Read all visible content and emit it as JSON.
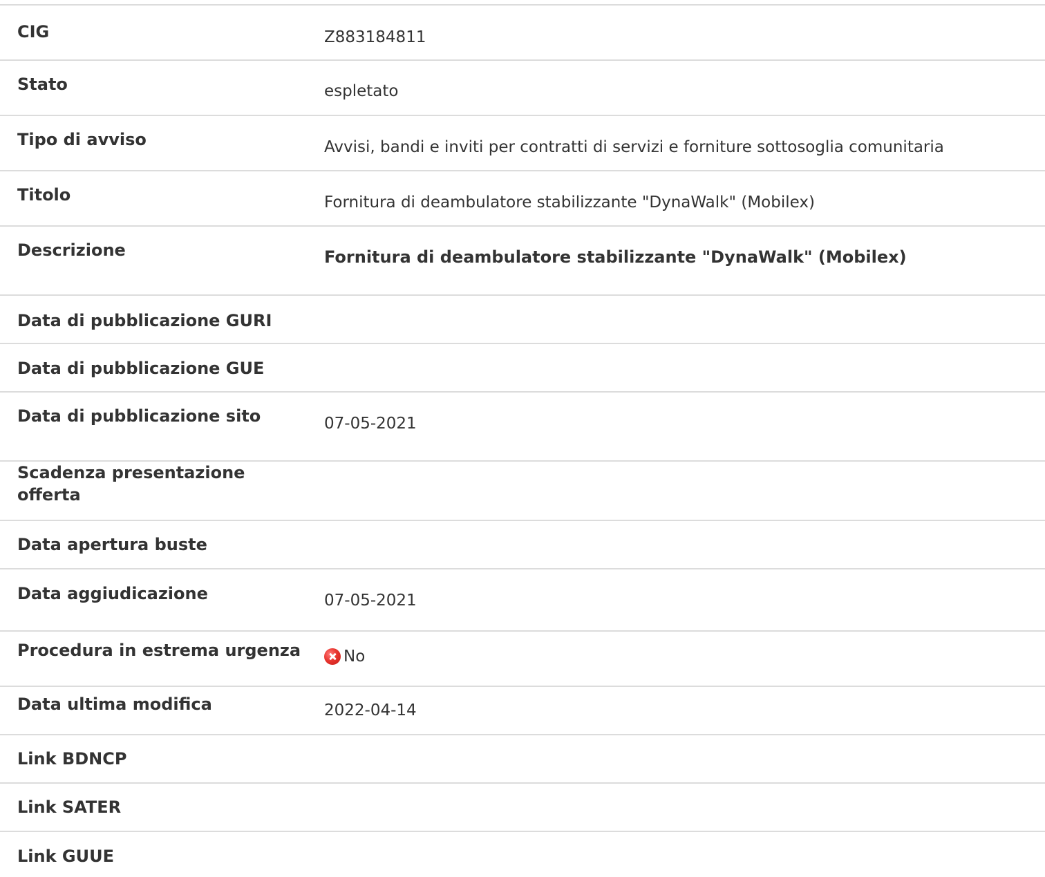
{
  "rows": [
    {
      "label": "CIG",
      "value": "Z883184811"
    },
    {
      "label": "Stato",
      "value": "espletato"
    },
    {
      "label": "Tipo di avviso",
      "value": "Avvisi, bandi e inviti per contratti di servizi e forniture sottosoglia comunitaria"
    },
    {
      "label": "Titolo",
      "value": "Fornitura di deambulatore stabilizzante \"DynaWalk\" (Mobilex)"
    },
    {
      "label": "Descrizione",
      "value": "Fornitura di deambulatore stabilizzante \"DynaWalk\" (Mobilex)"
    },
    {
      "label": "Data di pubblicazione GURI",
      "value": ""
    },
    {
      "label": "Data di pubblicazione GUE",
      "value": ""
    },
    {
      "label": "Data di pubblicazione sito",
      "value": "07-05-2021"
    },
    {
      "label": "Scadenza presentazione offerta",
      "value": ""
    },
    {
      "label": "Data apertura buste",
      "value": ""
    },
    {
      "label": "Data aggiudicazione",
      "value": "07-05-2021"
    },
    {
      "label": "Procedura in estrema urgenza",
      "value": "No",
      "icon": "red-x-circle-icon"
    },
    {
      "label": "Data ultima modifica",
      "value": "2022-04-14"
    },
    {
      "label": "Link BDNCP",
      "value": ""
    },
    {
      "label": "Link SATER",
      "value": ""
    },
    {
      "label": "Link GUUE",
      "value": ""
    }
  ],
  "colors": {
    "text": "#333333",
    "divider": "#dcdcdc",
    "no_icon": "#e8352f"
  }
}
